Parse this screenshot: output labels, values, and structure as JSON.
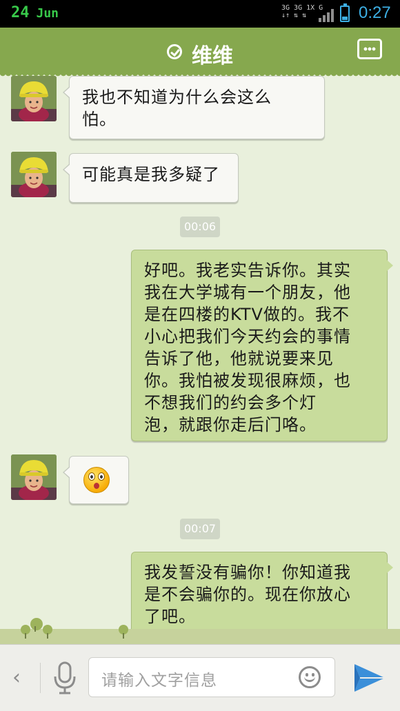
{
  "status_bar": {
    "date_day": "24",
    "date_month": "Jun",
    "network_top": "3G 3G 1X  G",
    "network_bottom": "↓↑ ⇅ ⇅",
    "time": "0:27",
    "battery_level": 0.3
  },
  "header": {
    "title": "维维",
    "status_icon": "check-circle-icon",
    "more_icon": "more-icon"
  },
  "messages": [
    {
      "side": "received",
      "text_lines": [
        "我也不知道为什么会这么",
        "怕。"
      ]
    },
    {
      "side": "received",
      "text_lines": [
        "可能真是我多疑了"
      ]
    },
    {
      "type": "timestamp",
      "text": "00:06"
    },
    {
      "side": "sent",
      "text_lines": [
        "好吧。我老实告诉你。其实",
        "我在大学城有一个朋友，他",
        "是在四楼的KTV做的。我不",
        "小心把我们今天约会的事情",
        "告诉了他，他就说要来见",
        "你。我怕被发现很麻烦，也",
        "不想我们的约会多个灯",
        "泡，就跟你走后门咯。"
      ]
    },
    {
      "side": "received",
      "type": "emoji",
      "emoji": "surprised-face-icon"
    },
    {
      "type": "timestamp",
      "text": "00:07"
    },
    {
      "side": "sent",
      "text_lines": [
        "我发誓没有骗你！你知道我",
        "是不会骗你的。现在你放心",
        "了吧。"
      ]
    }
  ],
  "input_bar": {
    "back_icon": "chevron-left-icon",
    "voice_icon": "microphone-icon",
    "placeholder": "请输入文字信息",
    "emoji_icon": "smiley-icon",
    "send_icon": "send-icon"
  },
  "colors": {
    "header_bg": "#86a84e",
    "chat_bg": "#e9f0dc",
    "sent_bubble": "#c8dc9c",
    "received_bubble": "#f8f8f4",
    "clock_accent": "#3dafe4"
  }
}
